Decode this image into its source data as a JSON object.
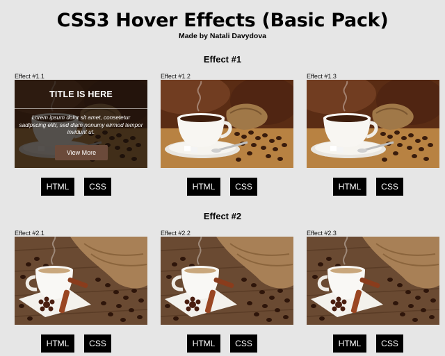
{
  "page": {
    "title": "CSS3 Hover Effects (Basic Pack)",
    "subtitle": "Made by Natali Davydova"
  },
  "sections": [
    {
      "title": "Effect #1",
      "cards": [
        {
          "label": "Effect #1.1",
          "html_btn": "HTML",
          "css_btn": "CSS"
        },
        {
          "label": "Effect #1.2",
          "html_btn": "HTML",
          "css_btn": "CSS"
        },
        {
          "label": "Effect #1.3",
          "html_btn": "HTML",
          "css_btn": "CSS"
        }
      ]
    },
    {
      "title": "Effect #2",
      "cards": [
        {
          "label": "Effect #2.1",
          "html_btn": "HTML",
          "css_btn": "CSS"
        },
        {
          "label": "Effect #2.2",
          "html_btn": "HTML",
          "css_btn": "CSS"
        },
        {
          "label": "Effect #2.3",
          "html_btn": "HTML",
          "css_btn": "CSS"
        }
      ]
    }
  ],
  "overlay": {
    "title": "TITLE IS HERE",
    "text": "Lorem ipsum dolor sit amet, consetetur sadipscing elitr, sed diam nonumy eirmod tempor invidunt ut.",
    "button": "View More"
  },
  "colors": {
    "page_bg": "#e6e6e6",
    "button_bg": "#000000",
    "overlay_button_bg": "#6b4a3a"
  }
}
